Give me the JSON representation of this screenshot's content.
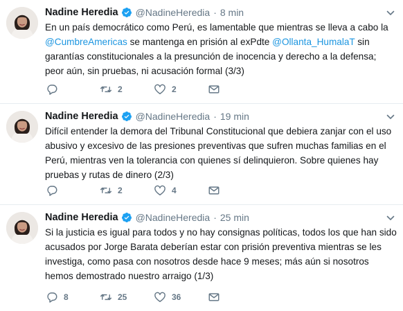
{
  "tweets": [
    {
      "name": "Nadine Heredia",
      "handle": "@NadineHeredia",
      "separator": "·",
      "time": "8 min",
      "body": [
        {
          "t": "En un país democrático como Perú, es lamentable que mientras se lleva a cabo la "
        },
        {
          "t": "@CumbreAmericas",
          "m": true
        },
        {
          "t": " se mantenga en prisión al exPdte "
        },
        {
          "t": "@Ollanta_HumalaT",
          "m": true
        },
        {
          "t": " sin garantías constitucionales a la presunción de inocencia y derecho a la defensa; peor aún, sin pruebas, ni acusación formal (3/3)"
        }
      ],
      "replies": "",
      "retweets": "2",
      "likes": "2"
    },
    {
      "name": "Nadine Heredia",
      "handle": "@NadineHeredia",
      "separator": "·",
      "time": "19 min",
      "body": [
        {
          "t": "Difícil entender la demora del Tribunal Constitucional que debiera zanjar con el uso abusivo y excesivo de las presiones preventivas que sufren muchas familias en el Perú, mientras ven la tolerancia con quienes sí delinquieron. Sobre quienes hay pruebas y rutas de dinero (2/3)"
        }
      ],
      "replies": "",
      "retweets": "2",
      "likes": "4"
    },
    {
      "name": "Nadine Heredia",
      "handle": "@NadineHeredia",
      "separator": "·",
      "time": "25 min",
      "body": [
        {
          "t": "Si la justicia es igual para todos y no hay consignas políticas, todos los que han sido acusados por Jorge Barata deberían estar con prisión preventiva mientras se les investiga, como pasa con nosotros desde hace 9 meses; más aún si nosotros hemos demostrado nuestro arraigo (1/3)"
        }
      ],
      "replies": "8",
      "retweets": "25",
      "likes": "36"
    }
  ],
  "icons": {
    "verified": "verified-badge-icon",
    "caret": "chevron-down-icon",
    "reply": "reply-icon",
    "retweet": "retweet-icon",
    "like": "heart-icon",
    "message": "envelope-icon"
  },
  "colors": {
    "text": "#14171a",
    "secondary": "#657786",
    "link": "#1b95e0",
    "verified": "#1da1f2",
    "divider": "#e6ecf0"
  }
}
